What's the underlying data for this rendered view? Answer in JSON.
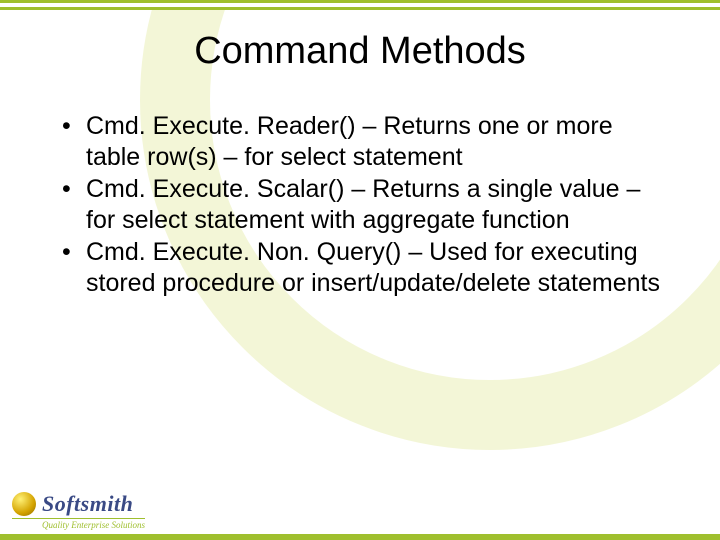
{
  "title": "Command Methods",
  "bullets": [
    "Cmd. Execute. Reader() – Returns one or more table row(s) – for select statement",
    "Cmd. Execute. Scalar() – Returns a single value – for select statement with aggregate function",
    "Cmd. Execute. Non. Query() – Used for executing stored procedure or insert/update/delete statements"
  ],
  "logo": {
    "name": "Softsmith",
    "tagline": "Quality Enterprise Solutions"
  }
}
